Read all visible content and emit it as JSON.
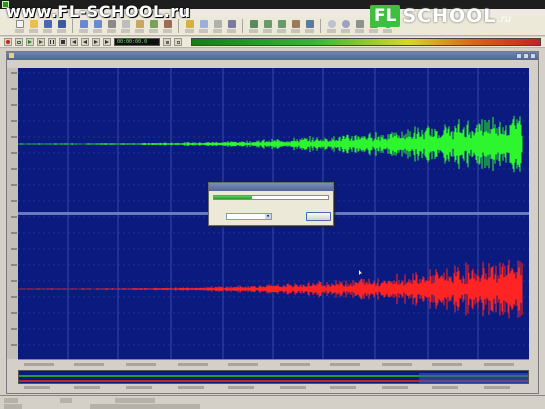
{
  "window": {
    "title": ""
  },
  "watermark": {
    "url_text": "www.FL-SCHOOL.ru"
  },
  "logo": {
    "fl": "FL",
    "school": "SCHOOL",
    "ru": ".ru"
  },
  "menu": {
    "items": [
      "",
      "",
      "",
      "",
      "",
      "",
      "",
      "",
      ""
    ]
  },
  "transport": {
    "lcd_value": "00:00:00.0",
    "colors": {
      "meter_low": "#1a7a1a",
      "meter_high": "#c82020"
    }
  },
  "editor": {
    "document_title": "",
    "waveform_colors": {
      "background": "#0b1a7e",
      "left_channel": "#2ef62e",
      "right_channel": "#ff2424",
      "grid": "#3a4aa6"
    }
  },
  "dialog": {
    "title": "",
    "progress_fraction": 0.33,
    "time_remaining_label": "",
    "time_remaining_value": "",
    "priority_label": "",
    "priority_value": "",
    "cancel_label": ""
  },
  "statusbar": {
    "items": [
      "",
      "",
      "",
      "",
      ""
    ]
  }
}
